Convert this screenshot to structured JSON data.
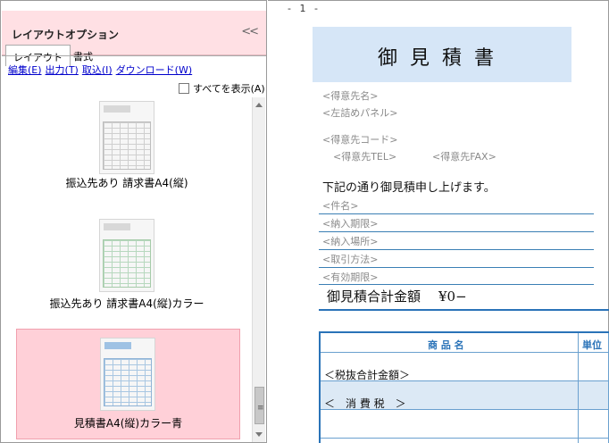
{
  "panel": {
    "title": "レイアウトオプション",
    "collapse_glyph": "<<",
    "tabs": [
      {
        "label": "レイアウト",
        "active": true
      },
      {
        "label": "書式",
        "active": false
      }
    ],
    "menu": [
      "編集(E)",
      "出力(T)",
      "取込(I)",
      "ダウンロード(W)"
    ],
    "show_all_label": "すべてを表示(A)",
    "templates": [
      {
        "label": "振込先あり 請求書A4(縦)",
        "selected": false
      },
      {
        "label": "振込先あり 請求書A4(縦)カラー",
        "selected": false
      },
      {
        "label": "見積書A4(縦)カラー青",
        "selected": true
      }
    ],
    "scroll_grip": "≡"
  },
  "document": {
    "page_number": "- 1 -",
    "title": "御見積書",
    "fields": {
      "customer_name": "<得意先名>",
      "left_panel": "<左詰めパネル>",
      "customer_code": "<得意先コード>",
      "customer_tel": "<得意先TEL>",
      "customer_fax": "<得意先FAX>"
    },
    "intro": "下記の通り御見積申し上げます。",
    "conditions": [
      "<件名>",
      "<納入期限>",
      "<納入場所>",
      "<取引方法>",
      "<有効期限>"
    ],
    "total_label": "御見積合計金額",
    "total_amount": "¥0−",
    "table": {
      "header_item": "商 品 名",
      "header_unit": "単位",
      "row_subtotal": "＜税抜合計金額＞",
      "row_tax": "＜　消 費 税　＞"
    },
    "colors": {
      "accent": "#2a73b8",
      "title_bg": "#d6e6f7",
      "panel_bg": "#ffe0e4",
      "selected_bg": "#ffd0d8"
    }
  }
}
